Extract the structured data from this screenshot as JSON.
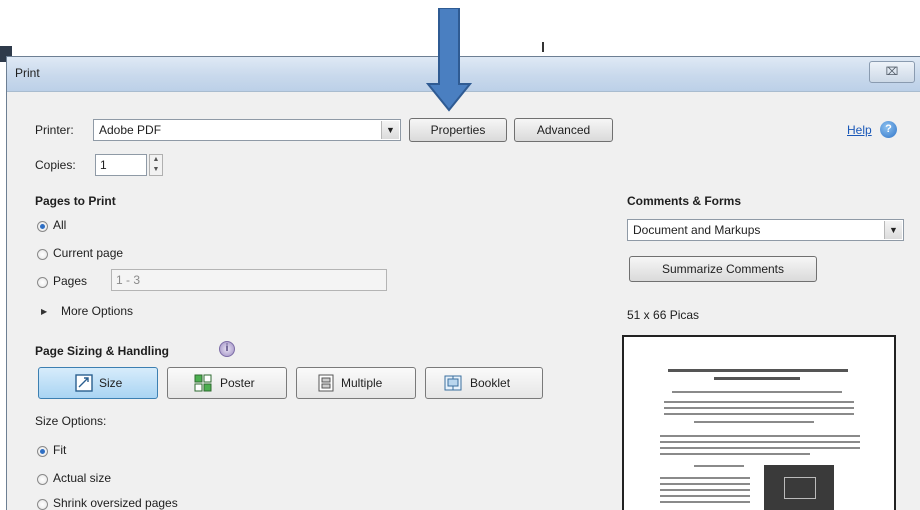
{
  "dialog": {
    "title": "Print",
    "close_label": "⌧"
  },
  "printer": {
    "label": "Printer:",
    "selected": "Adobe PDF",
    "properties_label": "Properties",
    "advanced_label": "Advanced"
  },
  "help": {
    "label": "Help",
    "icon": "help-icon"
  },
  "copies": {
    "label": "Copies:",
    "value": "1"
  },
  "pages_to_print": {
    "heading": "Pages to Print",
    "options": [
      {
        "label": "All",
        "selected": true
      },
      {
        "label": "Current page",
        "selected": false
      },
      {
        "label": "Pages",
        "selected": false
      }
    ],
    "pages_value": "1 - 3",
    "more_options_label": "More Options"
  },
  "page_sizing": {
    "heading": "Page Sizing & Handling",
    "info_icon": "info-icon",
    "buttons": [
      {
        "label": "Size",
        "icon": "size-icon",
        "active": true
      },
      {
        "label": "Poster",
        "icon": "poster-icon",
        "active": false
      },
      {
        "label": "Multiple",
        "icon": "multiple-icon",
        "active": false
      },
      {
        "label": "Booklet",
        "icon": "booklet-icon",
        "active": false
      }
    ],
    "size_options_label": "Size Options:",
    "size_options": [
      {
        "label": "Fit",
        "selected": true
      },
      {
        "label": "Actual size",
        "selected": false
      },
      {
        "label": "Shrink oversized pages",
        "selected": false
      }
    ]
  },
  "comments_forms": {
    "heading": "Comments & Forms",
    "selected": "Document and Markups",
    "summarize_label": "Summarize Comments"
  },
  "preview": {
    "size_label": "51 x 66 Picas"
  },
  "colors": {
    "arrow": "#4a7fc1",
    "arrow_border": "#2f5b93",
    "active_button": "#a9d4f3",
    "link": "#1a58b8"
  }
}
